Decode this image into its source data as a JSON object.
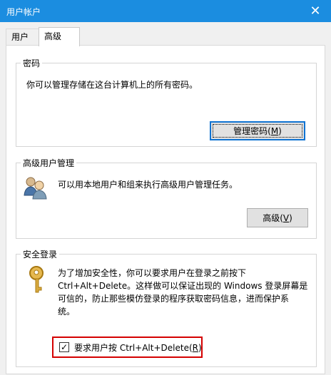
{
  "window": {
    "title": "用户帐户",
    "close_symbol": "✕"
  },
  "tabs": [
    {
      "label": "用户"
    },
    {
      "label": "高级"
    }
  ],
  "password_group": {
    "title": "密码",
    "description": "你可以管理存储在这台计算机上的所有密码。",
    "button_label_prefix": "管理密码(",
    "button_hotkey": "M",
    "button_label_suffix": ")"
  },
  "advanced_user_group": {
    "title": "高级用户管理",
    "description": "可以用本地用户和组来执行高级用户管理任务。",
    "button_label_prefix": "高级(",
    "button_hotkey": "V",
    "button_label_suffix": ")",
    "icon": "users-icon"
  },
  "secure_login_group": {
    "title": "安全登录",
    "description_lines": [
      "为了增加安全性，你可以要求用户在登录之前按下",
      "Ctrl+Alt+Delete。这样做可以保证出现的 Windows 登录屏幕是",
      "可信的，防止那些模仿登录的程序获取密码信息，进而保护系",
      "统。"
    ],
    "checkbox_checked": true,
    "checkbox_mark": "✓",
    "checkbox_label_prefix": "要求用户按 Ctrl+Alt+Delete(",
    "checkbox_hotkey": "R",
    "checkbox_label_suffix": ")",
    "icon": "key-icon"
  },
  "colors": {
    "titlebar": "#1b8de0",
    "focus_border": "#0f73d2",
    "highlight_red": "#d40000"
  }
}
